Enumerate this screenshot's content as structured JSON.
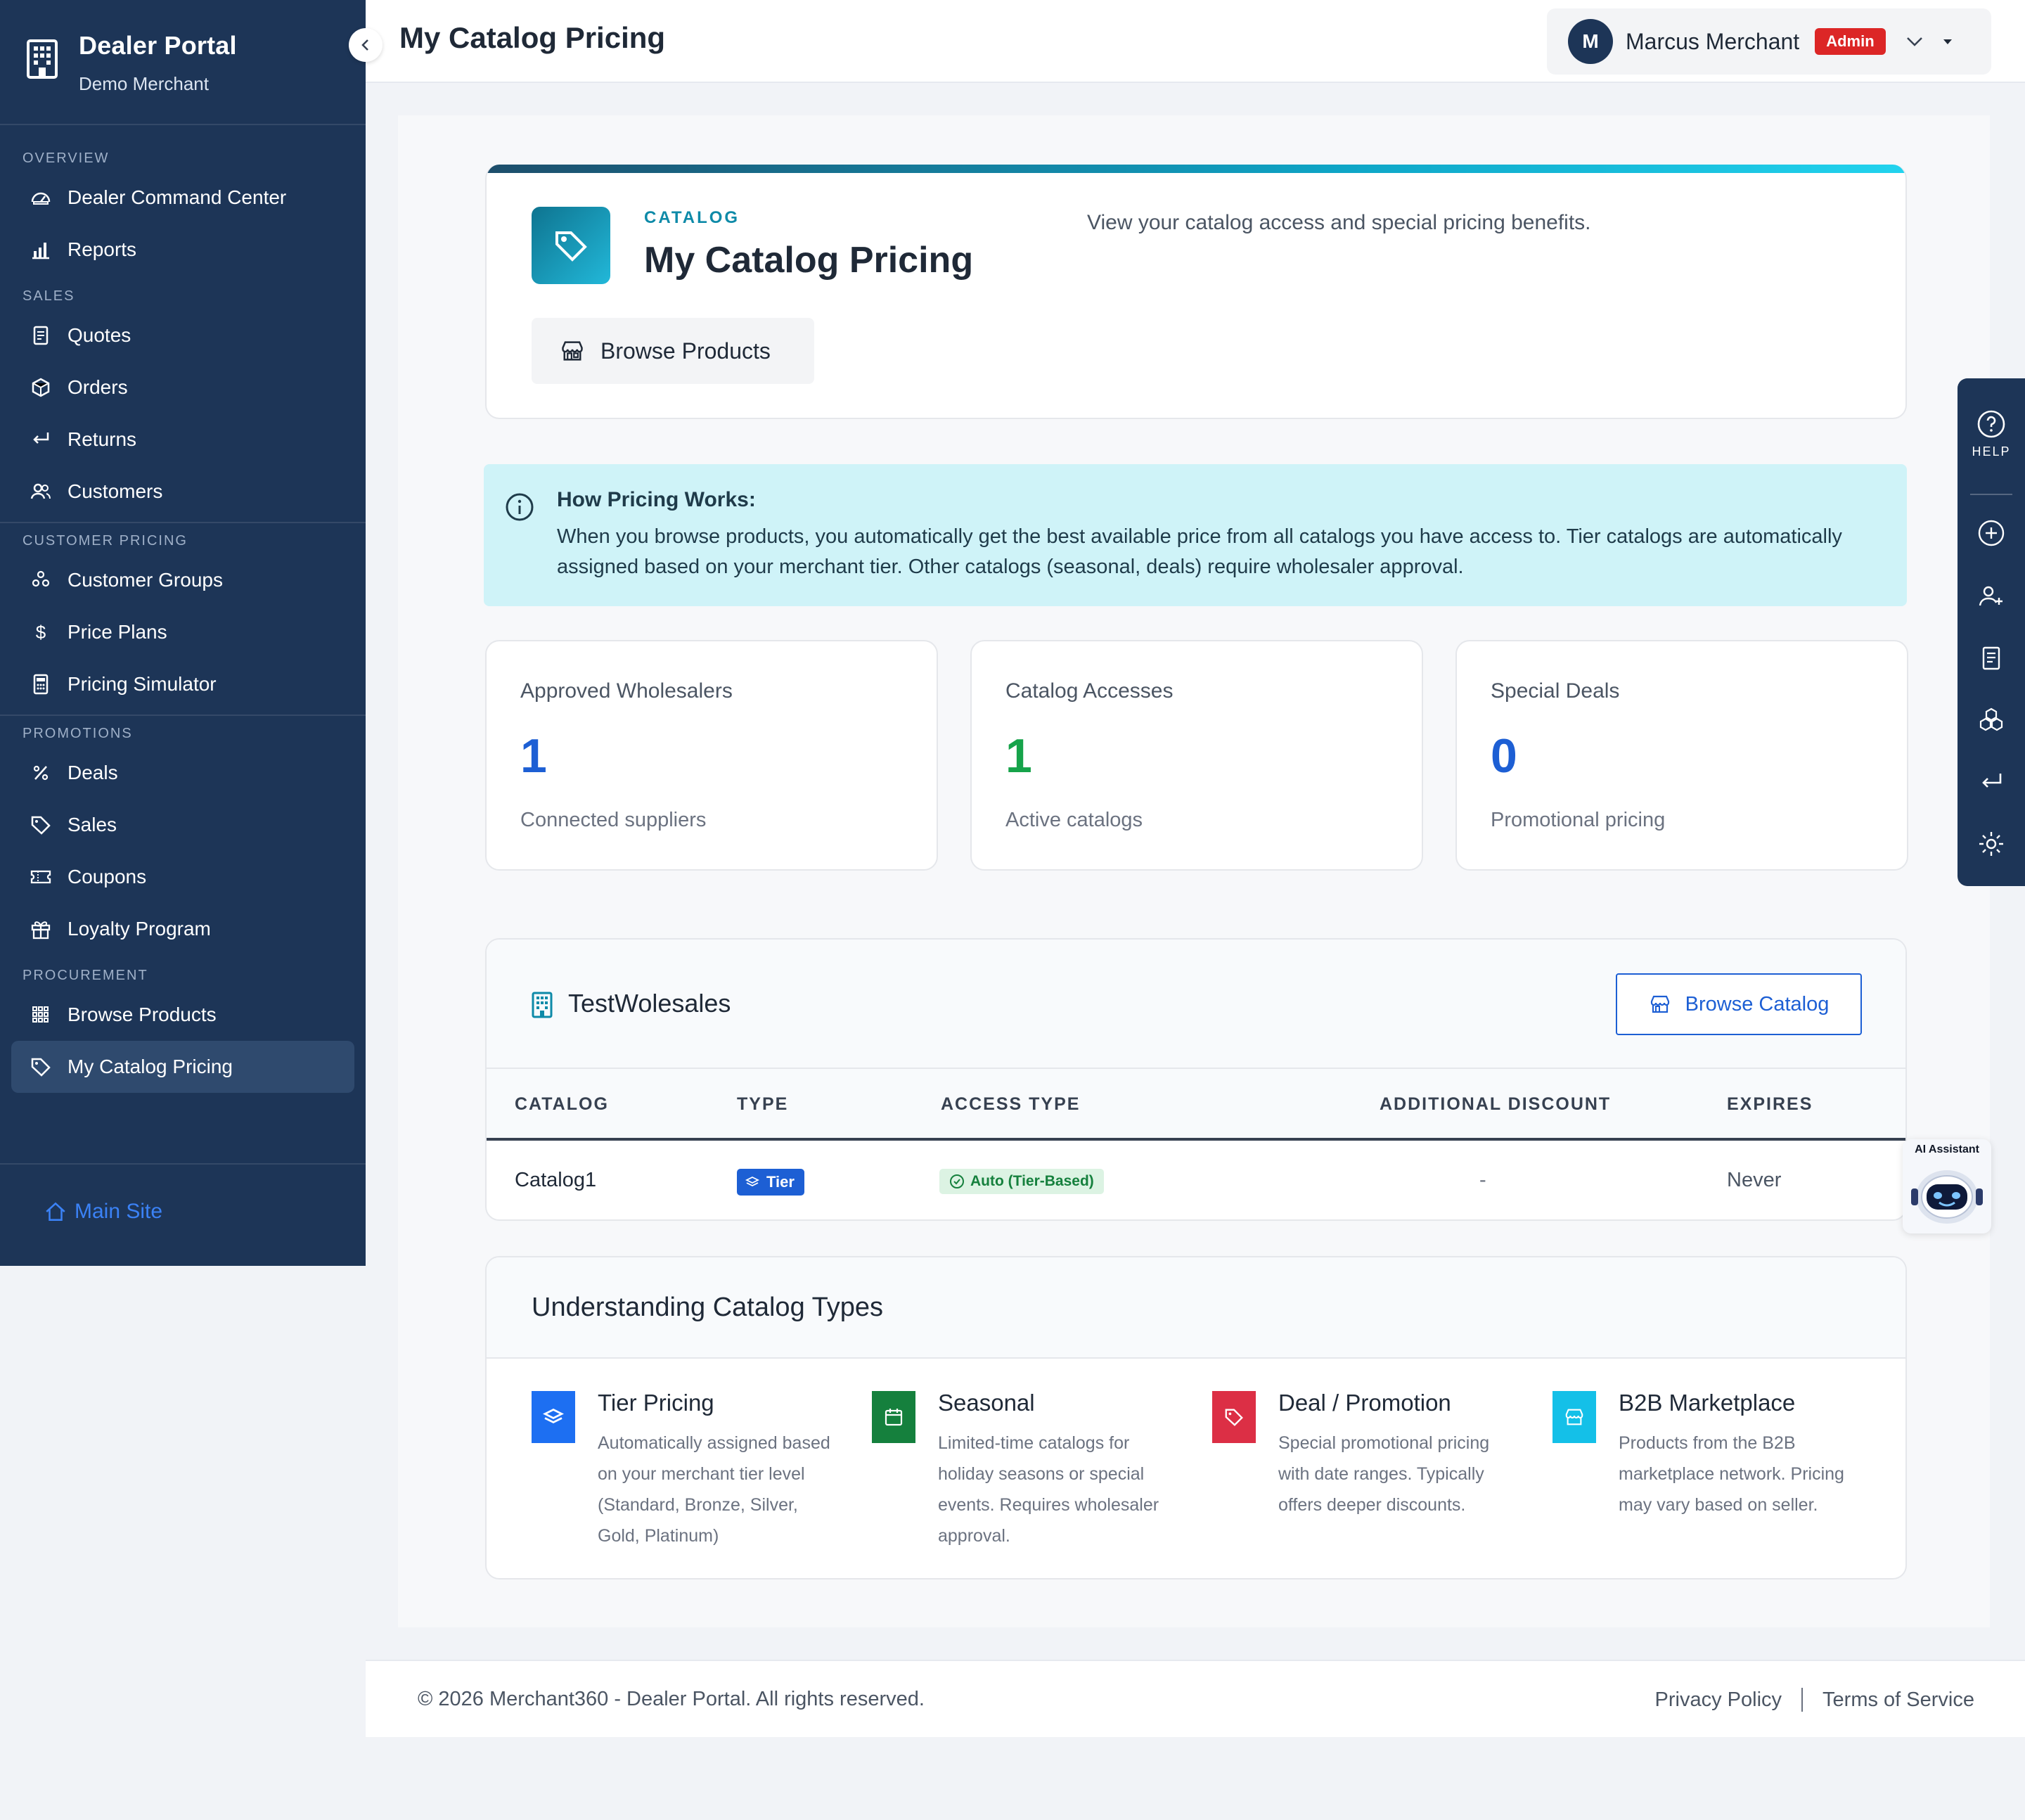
{
  "sidebar": {
    "brand_title": "Dealer Portal",
    "brand_sub": "Demo Merchant",
    "sections": {
      "overview": "OVERVIEW",
      "sales": "SALES",
      "customer_pricing": "CUSTOMER PRICING",
      "promotions": "PROMOTIONS",
      "procurement": "PROCUREMENT"
    },
    "items": {
      "dealer_command_center": "Dealer Command Center",
      "reports": "Reports",
      "quotes": "Quotes",
      "orders": "Orders",
      "returns": "Returns",
      "customers": "Customers",
      "customer_groups": "Customer Groups",
      "price_plans": "Price Plans",
      "pricing_simulator": "Pricing Simulator",
      "deals": "Deals",
      "sales": "Sales",
      "coupons": "Coupons",
      "loyalty_program": "Loyalty Program",
      "browse_products": "Browse Products",
      "my_catalog_pricing": "My Catalog Pricing"
    },
    "main_site": "Main Site"
  },
  "header": {
    "title": "My Catalog Pricing",
    "user_initial": "M",
    "user_name": "Marcus Merchant",
    "role_badge": "Admin"
  },
  "hero": {
    "eyebrow": "CATALOG",
    "title": "My Catalog Pricing",
    "description": "View your catalog access and special pricing benefits.",
    "button": "Browse Products"
  },
  "info": {
    "title": "How Pricing Works:",
    "text": "When you browse products, you automatically get the best available price from all catalogs you have access to. Tier catalogs are automatically assigned based on your merchant tier. Other catalogs (seasonal, deals) require wholesaler approval."
  },
  "stats": [
    {
      "label": "Approved Wholesalers",
      "value": "1",
      "sub": "Connected suppliers",
      "color": "#1d5fd4"
    },
    {
      "label": "Catalog Accesses",
      "value": "1",
      "sub": "Active catalogs",
      "color": "#16a34a"
    },
    {
      "label": "Special Deals",
      "value": "0",
      "sub": "Promotional pricing",
      "color": "#1d5fd4"
    }
  ],
  "supplier": {
    "name": "TestWolesales",
    "browse_button": "Browse Catalog",
    "columns": [
      "CATALOG",
      "TYPE",
      "ACCESS TYPE",
      "ADDITIONAL DISCOUNT",
      "EXPIRES"
    ],
    "rows": [
      {
        "catalog": "Catalog1",
        "type": "Tier",
        "access": "Auto (Tier-Based)",
        "discount": "-",
        "expires": "Never"
      }
    ]
  },
  "types": {
    "title": "Understanding Catalog Types",
    "items": [
      {
        "title": "Tier Pricing",
        "desc": "Automatically assigned based on your merchant tier level (Standard, Bronze, Silver, Gold, Platinum)",
        "color": "#1d6ff2"
      },
      {
        "title": "Seasonal",
        "desc": "Limited-time catalogs for holiday seasons or special events. Requires wholesaler approval.",
        "color": "#15803d"
      },
      {
        "title": "Deal / Promotion",
        "desc": "Special promotional pricing with date ranges. Typically offers deeper discounts.",
        "color": "#dc2f45"
      },
      {
        "title": "B2B Marketplace",
        "desc": "Products from the B2B marketplace network. Pricing may vary based on seller.",
        "color": "#14c0e8"
      }
    ]
  },
  "footer": {
    "copyright": "© 2026 Merchant360 - Dealer Portal. All rights reserved.",
    "privacy": "Privacy Policy",
    "terms": "Terms of Service"
  },
  "dock": {
    "help": "HELP"
  },
  "ai": {
    "label": "AI Assistant"
  }
}
